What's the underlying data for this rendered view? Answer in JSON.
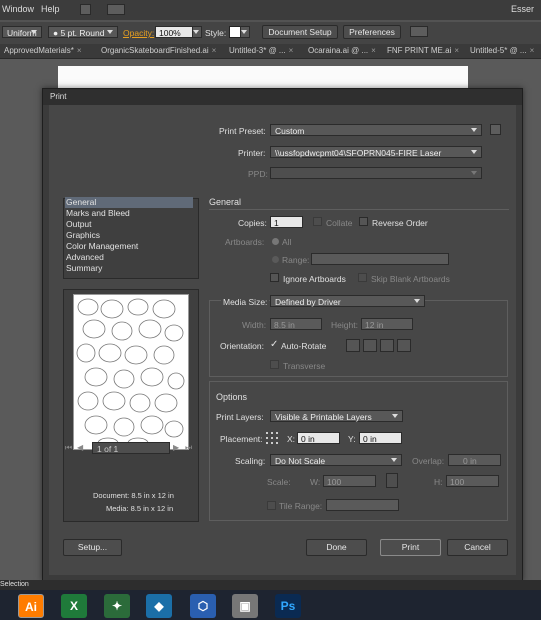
{
  "menubar": {
    "window": "Window",
    "help": "Help",
    "user": "Esser"
  },
  "controlbar": {
    "stroke_profile": "Uniform",
    "brush": "5 pt. Round",
    "opacity_label": "Opacity:",
    "opacity_value": "100%",
    "style_label": "Style:",
    "document_setup": "Document Setup",
    "preferences": "Preferences"
  },
  "tabs": [
    {
      "label": "ApprovedMaterials*"
    },
    {
      "label": "OrganicSkateboardFinished.ai"
    },
    {
      "label": "Untitled-3* @ ..."
    },
    {
      "label": "Ocaraina.ai @ ..."
    },
    {
      "label": "FNF PRINT ME.ai"
    },
    {
      "label": "Untitled-5* @ ..."
    }
  ],
  "dialog": {
    "title": "Print",
    "print_preset_label": "Print Preset:",
    "print_preset_value": "Custom",
    "printer_label": "Printer:",
    "printer_value": "\\\\ussfopdwcpmt04\\SFOPRN045-FIRE Laser",
    "ppd_label": "PPD:",
    "sections": [
      "General",
      "Marks and Bleed",
      "Output",
      "Graphics",
      "Color Management",
      "Advanced",
      "Summary"
    ],
    "preview": {
      "page_counter": "1 of 1",
      "document_label": "Document: 8.5 in x 12 in",
      "media_label": "Media: 8.5 in x 12 in"
    },
    "general": {
      "heading": "General",
      "copies_label": "Copies:",
      "copies_value": "1",
      "collate": "Collate",
      "reverse_order": "Reverse Order",
      "artboards_label": "Artboards:",
      "all": "All",
      "range": "Range:",
      "ignore_artboards": "Ignore Artboards",
      "skip_blank": "Skip Blank Artboards"
    },
    "media": {
      "size_label": "Media Size:",
      "size_value": "Defined by Driver",
      "width_label": "Width:",
      "width_value": "8.5 in",
      "height_label": "Height:",
      "height_value": "12 in",
      "orientation_label": "Orientation:",
      "auto_rotate": "Auto-Rotate",
      "transverse": "Transverse"
    },
    "options": {
      "heading": "Options",
      "print_layers_label": "Print Layers:",
      "print_layers_value": "Visible & Printable Layers",
      "placement_label": "Placement:",
      "x_label": "X:",
      "x_value": "0 in",
      "y_label": "Y:",
      "y_value": "0 in",
      "scaling_label": "Scaling:",
      "scaling_value": "Do Not Scale",
      "overlap_label": "Overlap:",
      "overlap_value": "0 in",
      "scale_label": "Scale:",
      "w_label": "W:",
      "w_value": "100",
      "h_label": "H:",
      "h_value": "100",
      "tile_range_label": "Tile Range:"
    },
    "buttons": {
      "setup": "Setup...",
      "done": "Done",
      "print": "Print",
      "cancel": "Cancel"
    }
  },
  "status": {
    "text": "Selection"
  },
  "taskbar": [
    {
      "name": "illustrator",
      "glyph": "Ai",
      "color": "#ff7c00"
    },
    {
      "name": "excel",
      "glyph": "X",
      "color": "#1f7a3a"
    },
    {
      "name": "app3",
      "glyph": "✦",
      "color": "#2b6b3a"
    },
    {
      "name": "app4",
      "glyph": "◆",
      "color": "#1b6fa8"
    },
    {
      "name": "app5",
      "glyph": "⬡",
      "color": "#2a5fb0"
    },
    {
      "name": "app6",
      "glyph": "▣",
      "color": "#777777"
    },
    {
      "name": "photoshop",
      "glyph": "Ps",
      "color": "#0a2a52"
    }
  ]
}
